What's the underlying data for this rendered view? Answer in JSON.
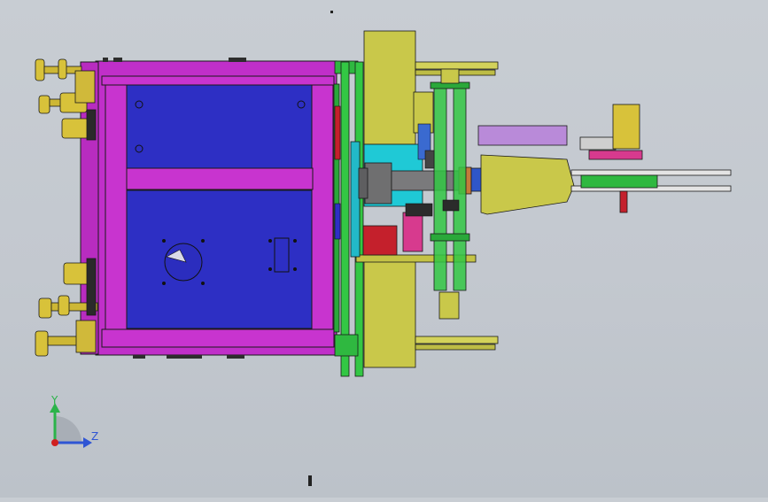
{
  "viewport": {
    "background": "#c5cad1",
    "triad": {
      "y_label": "Y",
      "z_label": "Z",
      "y_color": "#2bb34a",
      "z_color": "#2f55d4",
      "x_color": "#d02020"
    }
  },
  "colors": {
    "frame_magenta": "#c02fc9",
    "panel_blue": "#2d2fc4",
    "plate_olive": "#c9c84a",
    "rail_green": "#33c744",
    "shaft_gray": "#6f6f70",
    "housing_cyan": "#1fc9d6",
    "motor_red": "#c4202c",
    "foot_gold": "#d8c23a",
    "edge": "#1a1a1a"
  }
}
